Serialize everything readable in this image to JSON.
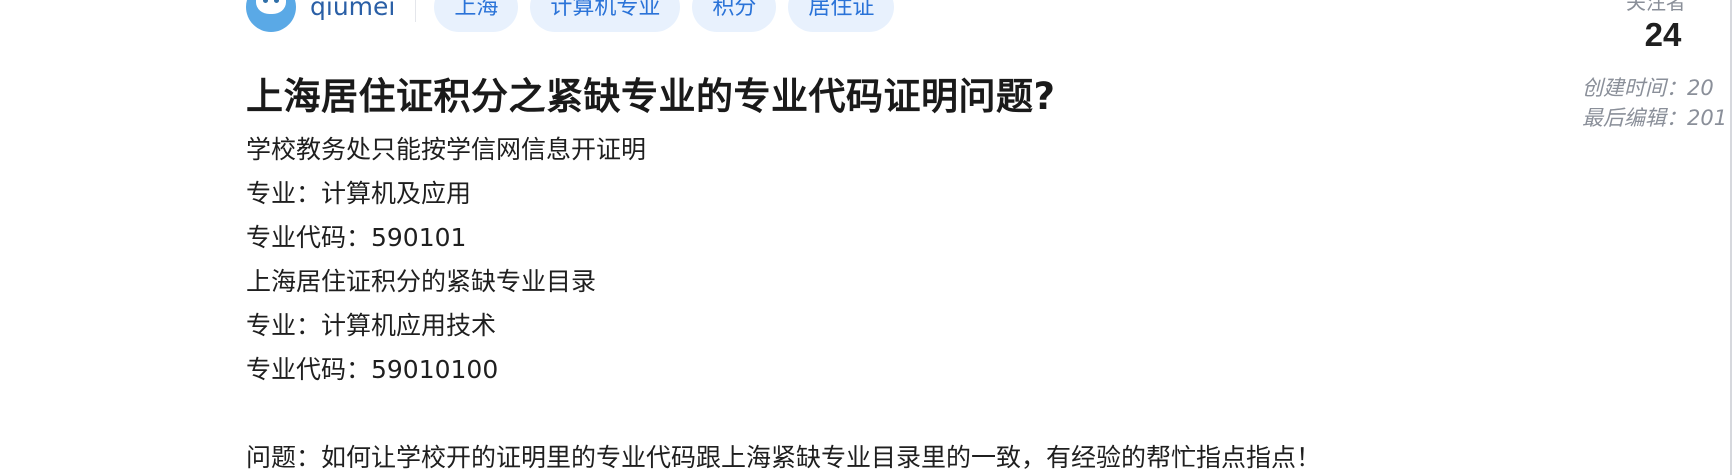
{
  "author": {
    "username": "qiumei"
  },
  "tags": [
    "上海",
    "计算机专业",
    "积分",
    "居住证"
  ],
  "stats": {
    "followers_label": "关注者",
    "followers_value": "24",
    "created_label": "创建时间：20",
    "edited_label": "最后编辑：201"
  },
  "question": {
    "title": "上海居住证积分之紧缺专业的专业代码证明问题?",
    "lines": [
      "学校教务处只能按学信网信息开证明",
      "专业：计算机及应用",
      "专业代码：590101",
      "上海居住证积分的紧缺专业目录",
      "专业：计算机应用技术",
      "专业代码：59010100"
    ],
    "question_line": "问题：如何让学校开的证明里的专业代码跟上海紧缺专业目录里的一致，有经验的帮忙指点指点！"
  }
}
